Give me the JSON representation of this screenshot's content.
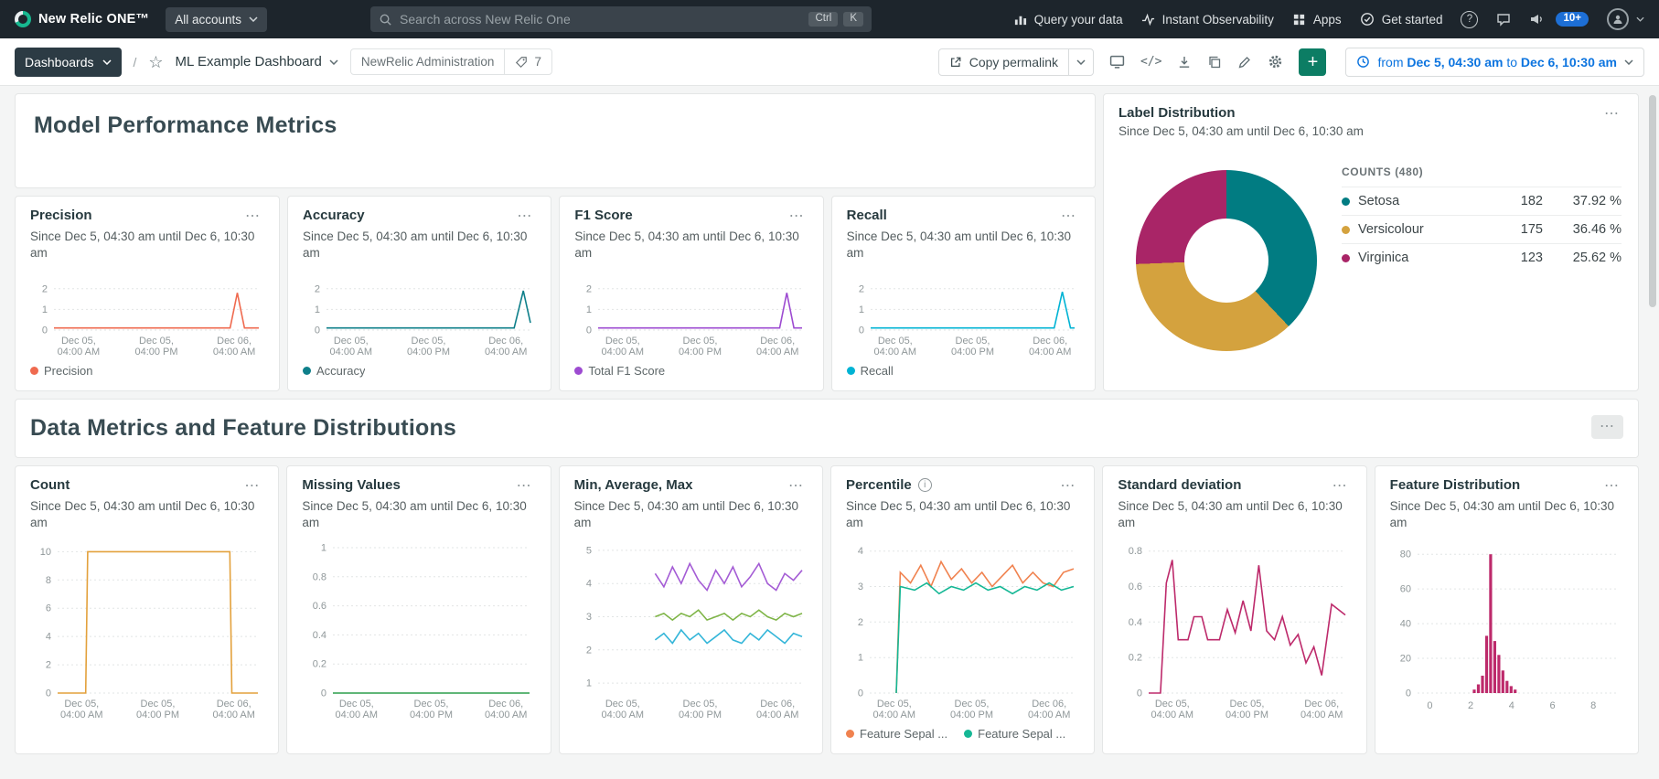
{
  "icons": {
    "more": "⋯",
    "star": "☆",
    "plus": "+",
    "help": "?",
    "code": "</>",
    "info": "i"
  },
  "topbar": {
    "brand": "New Relic ONE™",
    "accounts": "All accounts",
    "search": {
      "placeholder": "Search across New Relic One",
      "key_ctrl": "Ctrl",
      "key_k": "K"
    },
    "query_your_data": "Query your data",
    "instant_observability": "Instant Observability",
    "apps": "Apps",
    "get_started": "Get started",
    "notification_badge": "10+"
  },
  "toolbar": {
    "dashboards": "Dashboards",
    "separator": "/",
    "dashboard_name": "ML Example Dashboard",
    "account": "NewRelic Administration",
    "tag_count": "7",
    "copy_permalink": "Copy permalink",
    "time": {
      "from_label": "from",
      "start": "Dec 5, 04:30 am",
      "to_label": "to",
      "end": "Dec 6, 10:30 am"
    }
  },
  "common": {
    "since": "Since Dec 5, 04:30 am until Dec 6, 10:30 am"
  },
  "section1": {
    "heading": "Model Performance Metrics",
    "widgets": {
      "precision": {
        "title": "Precision",
        "legend": "Precision",
        "chart": {
          "type": "line",
          "ml": 26,
          "ylim": [
            0,
            2.3
          ],
          "yticks": [
            0,
            1,
            2
          ],
          "xlabels": [
            "Dec 05,|04:00 AM",
            "Dec 05,|04:00 PM",
            "Dec 06,|04:00 AM"
          ],
          "series": [
            {
              "name": "Precision",
              "color": "#ef6a4f",
              "points": [
                [
                  0,
                  0.1
                ],
                [
                  0.86,
                  0.1
                ],
                [
                  0.895,
                  1.8
                ],
                [
                  0.93,
                  0.1
                ],
                [
                  1,
                  0.1
                ]
              ]
            }
          ]
        }
      },
      "accuracy": {
        "title": "Accuracy",
        "legend": "Accuracy",
        "chart": {
          "type": "line",
          "ml": 26,
          "ylim": [
            0,
            2.3
          ],
          "yticks": [
            0,
            1,
            2
          ],
          "xlabels": [
            "Dec 05,|04:00 AM",
            "Dec 05,|04:00 PM",
            "Dec 06,|04:00 AM"
          ],
          "series": [
            {
              "name": "Accuracy",
              "color": "#0e7f8a",
              "points": [
                [
                  0,
                  0.1
                ],
                [
                  0.92,
                  0.1
                ],
                [
                  0.965,
                  1.9
                ],
                [
                  1,
                  0.35
                ]
              ]
            }
          ]
        }
      },
      "f1": {
        "title": "F1 Score",
        "legend": "Total F1 Score",
        "chart": {
          "type": "line",
          "ml": 26,
          "ylim": [
            0,
            2.3
          ],
          "yticks": [
            0,
            1,
            2
          ],
          "xlabels": [
            "Dec 05,|04:00 AM",
            "Dec 05,|04:00 PM",
            "Dec 06,|04:00 AM"
          ],
          "series": [
            {
              "name": "Total F1 Score",
              "color": "#9d4bd1",
              "points": [
                [
                  0,
                  0.1
                ],
                [
                  0.89,
                  0.1
                ],
                [
                  0.925,
                  1.8
                ],
                [
                  0.96,
                  0.1
                ],
                [
                  1,
                  0.1
                ]
              ]
            }
          ]
        }
      },
      "recall": {
        "title": "Recall",
        "legend": "Recall",
        "chart": {
          "type": "line",
          "ml": 26,
          "ylim": [
            0,
            2.3
          ],
          "yticks": [
            0,
            1,
            2
          ],
          "xlabels": [
            "Dec 05,|04:00 AM",
            "Dec 05,|04:00 PM",
            "Dec 06,|04:00 AM"
          ],
          "series": [
            {
              "name": "Recall",
              "color": "#00b3d4",
              "points": [
                [
                  0,
                  0.1
                ],
                [
                  0.9,
                  0.1
                ],
                [
                  0.94,
                  1.85
                ],
                [
                  0.98,
                  0.1
                ],
                [
                  1,
                  0.1
                ]
              ]
            }
          ]
        }
      }
    },
    "label_distribution": {
      "title": "Label Distribution",
      "counts_header": "COUNTS (480)",
      "chart_type": "donut",
      "rows": [
        {
          "label": "Setosa",
          "count": "182",
          "pct_text": "37.92 %",
          "pct": 37.92,
          "color": "#017c82"
        },
        {
          "label": "Versicolour",
          "count": "175",
          "pct_text": "36.46 %",
          "pct": 36.46,
          "color": "#d4a23e"
        },
        {
          "label": "Virginica",
          "count": "123",
          "pct_text": "25.62 %",
          "pct": 25.62,
          "color": "#a92567"
        }
      ]
    }
  },
  "section2": {
    "heading": "Data Metrics and Feature Distributions",
    "widgets": {
      "count": {
        "title": "Count",
        "chart": {
          "type": "line",
          "ml": 30,
          "ylim": [
            0,
            10.8
          ],
          "yticks": [
            0,
            2,
            4,
            6,
            8,
            10
          ],
          "xlabels": [
            "Dec 05,|04:00 AM",
            "Dec 05,|04:00 PM",
            "Dec 06,|04:00 AM"
          ],
          "series": [
            {
              "name": "Count",
              "color": "#e3a13c",
              "points": [
                [
                  0,
                  0
                ],
                [
                  0.14,
                  0
                ],
                [
                  0.15,
                  10
                ],
                [
                  0.5,
                  10
                ],
                [
                  0.86,
                  10
                ],
                [
                  0.87,
                  0
                ],
                [
                  1,
                  0
                ]
              ]
            }
          ]
        }
      },
      "missing": {
        "title": "Missing Values",
        "chart": {
          "type": "line",
          "ml": 34,
          "ylim": [
            0,
            1.05
          ],
          "yticks": [
            0,
            0.2,
            0.4,
            0.6,
            0.8,
            1
          ],
          "xlabels": [
            "Dec 05,|04:00 AM",
            "Dec 05,|04:00 PM",
            "Dec 06,|04:00 AM"
          ],
          "series": [
            {
              "name": "Missing Values",
              "color": "#2c9e4b",
              "points": [
                [
                  0,
                  0
                ],
                [
                  1,
                  0
                ]
              ]
            }
          ]
        }
      },
      "minavgmax": {
        "title": "Min, Average, Max",
        "chart": {
          "type": "line",
          "ml": 26,
          "ylim": [
            0.7,
            5.3
          ],
          "yticks": [
            1,
            2,
            3,
            4,
            5
          ],
          "xlabels": [
            "Dec 05,|04:00 AM",
            "Dec 05,|04:00 PM",
            "Dec 06,|04:00 AM"
          ],
          "series": [
            {
              "name": "Max",
              "color": "#a45cd5",
              "xstart": 0.28,
              "values": [
                4.3,
                3.9,
                4.5,
                4.0,
                4.6,
                4.1,
                3.8,
                4.4,
                4.0,
                4.5,
                3.9,
                4.2,
                4.6,
                4.0,
                3.8,
                4.3,
                4.1,
                4.4
              ]
            },
            {
              "name": "Average",
              "color": "#7fb548",
              "xstart": 0.28,
              "values": [
                3.0,
                3.1,
                2.9,
                3.1,
                3.0,
                3.2,
                2.9,
                3.0,
                3.1,
                2.9,
                3.1,
                3.0,
                3.2,
                3.0,
                2.9,
                3.1,
                3.0,
                3.1
              ]
            },
            {
              "name": "Min",
              "color": "#35b6d9",
              "xstart": 0.28,
              "values": [
                2.3,
                2.5,
                2.2,
                2.6,
                2.3,
                2.5,
                2.2,
                2.4,
                2.6,
                2.3,
                2.2,
                2.5,
                2.3,
                2.6,
                2.4,
                2.2,
                2.5,
                2.4
              ]
            }
          ]
        }
      },
      "percentile": {
        "title": "Percentile",
        "legends": [
          "Feature Sepal ...",
          "Feature Sepal ..."
        ],
        "chart": {
          "type": "line",
          "ml": 26,
          "ylim": [
            0,
            4.3
          ],
          "yticks": [
            0,
            1,
            2,
            3,
            4
          ],
          "xlabels": [
            "Dec 05,|04:00 AM",
            "Dec 05,|04:00 PM",
            "Dec 06,|04:00 AM"
          ],
          "series": [
            {
              "name": "Feature Sepal ...",
              "color": "#f0824f",
              "points": [
                [
                  0.13,
                  0
                ],
                [
                  0.15,
                  3.4
                ],
                [
                  0.2,
                  3.1
                ],
                [
                  0.25,
                  3.6
                ],
                [
                  0.3,
                  3.0
                ],
                [
                  0.35,
                  3.7
                ],
                [
                  0.4,
                  3.2
                ],
                [
                  0.45,
                  3.5
                ],
                [
                  0.5,
                  3.1
                ],
                [
                  0.55,
                  3.4
                ],
                [
                  0.6,
                  3.0
                ],
                [
                  0.65,
                  3.3
                ],
                [
                  0.7,
                  3.6
                ],
                [
                  0.75,
                  3.1
                ],
                [
                  0.8,
                  3.4
                ],
                [
                  0.85,
                  3.1
                ],
                [
                  0.9,
                  3.0
                ],
                [
                  0.95,
                  3.4
                ],
                [
                  1,
                  3.5
                ]
              ]
            },
            {
              "name": "Feature Sepal ...",
              "color": "#15b795",
              "points": [
                [
                  0.13,
                  0
                ],
                [
                  0.15,
                  3.0
                ],
                [
                  0.22,
                  2.9
                ],
                [
                  0.28,
                  3.1
                ],
                [
                  0.34,
                  2.8
                ],
                [
                  0.4,
                  3.0
                ],
                [
                  0.46,
                  2.9
                ],
                [
                  0.52,
                  3.1
                ],
                [
                  0.58,
                  2.9
                ],
                [
                  0.64,
                  3.0
                ],
                [
                  0.7,
                  2.8
                ],
                [
                  0.76,
                  3.0
                ],
                [
                  0.82,
                  2.9
                ],
                [
                  0.88,
                  3.1
                ],
                [
                  0.94,
                  2.9
                ],
                [
                  1,
                  3.0
                ]
              ]
            }
          ]
        }
      },
      "stddev": {
        "title": "Standard deviation",
        "chart": {
          "type": "line",
          "ml": 34,
          "ylim": [
            0,
            0.86
          ],
          "yticks": [
            0,
            0.2,
            0.4,
            0.6,
            0.8
          ],
          "xlabels": [
            "Dec 05,|04:00 AM",
            "Dec 05,|04:00 PM",
            "Dec 06,|04:00 AM"
          ],
          "series": [
            {
              "name": "Standard deviation",
              "color": "#bd2a6b",
              "points": [
                [
                  0,
                  0
                ],
                [
                  0.06,
                  0
                ],
                [
                  0.09,
                  0.62
                ],
                [
                  0.12,
                  0.75
                ],
                [
                  0.15,
                  0.3
                ],
                [
                  0.2,
                  0.3
                ],
                [
                  0.23,
                  0.43
                ],
                [
                  0.27,
                  0.43
                ],
                [
                  0.3,
                  0.3
                ],
                [
                  0.36,
                  0.3
                ],
                [
                  0.4,
                  0.47
                ],
                [
                  0.44,
                  0.34
                ],
                [
                  0.48,
                  0.52
                ],
                [
                  0.52,
                  0.35
                ],
                [
                  0.56,
                  0.72
                ],
                [
                  0.6,
                  0.35
                ],
                [
                  0.64,
                  0.3
                ],
                [
                  0.68,
                  0.43
                ],
                [
                  0.72,
                  0.27
                ],
                [
                  0.76,
                  0.33
                ],
                [
                  0.8,
                  0.17
                ],
                [
                  0.84,
                  0.26
                ],
                [
                  0.88,
                  0.1
                ],
                [
                  0.93,
                  0.5
                ],
                [
                  1,
                  0.44
                ]
              ]
            }
          ]
        }
      },
      "featdist": {
        "title": "Feature Distribution",
        "chart": {
          "type": "bar",
          "ml": 30,
          "ylim": [
            0,
            88
          ],
          "yticks": [
            0,
            20,
            40,
            60,
            80
          ],
          "xlim": [
            -0.6,
            9.2
          ],
          "xticks": [
            0,
            2,
            4,
            6,
            8
          ],
          "barw": 0.19,
          "color": "#bd2a6b",
          "bars": [
            [
              2.2,
              2
            ],
            [
              2.4,
              5
            ],
            [
              2.6,
              10
            ],
            [
              2.8,
              33
            ],
            [
              3.0,
              80
            ],
            [
              3.2,
              30
            ],
            [
              3.4,
              22
            ],
            [
              3.6,
              13
            ],
            [
              3.8,
              7
            ],
            [
              4.0,
              4
            ],
            [
              4.2,
              2
            ]
          ]
        }
      }
    }
  }
}
